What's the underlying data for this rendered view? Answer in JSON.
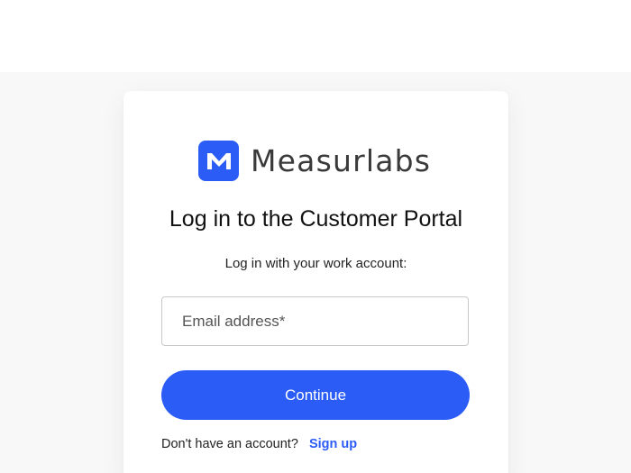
{
  "brand": {
    "name": "Measurlabs",
    "logo_color": "#2b5cf6"
  },
  "login": {
    "title": "Log in to the Customer Portal",
    "subtitle": "Log in with your work account:",
    "email_placeholder": "Email address*",
    "email_value": "",
    "continue_label": "Continue",
    "signup_prompt": "Don't have an account?",
    "signup_link": "Sign up"
  },
  "colors": {
    "accent": "#2b5cf6",
    "background": "#f8f8f8",
    "card": "#ffffff"
  }
}
